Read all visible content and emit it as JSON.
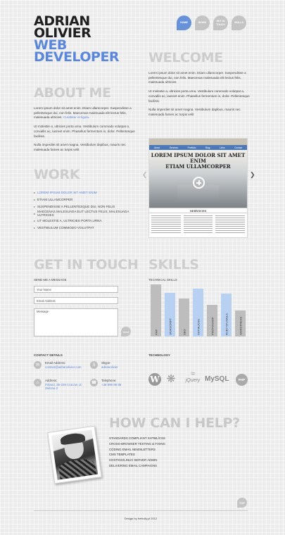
{
  "header": {
    "name_line1": "ADRIAN",
    "name_line2": "OLIVIER",
    "title_line1": "WEB",
    "title_line2": "DEVELOPER"
  },
  "nav": {
    "items": [
      {
        "label": "HOME",
        "active": true
      },
      {
        "label": "WORK",
        "active": false
      },
      {
        "label": "GET IN TOUCH",
        "active": false
      },
      {
        "label": "SKILLS",
        "active": false
      }
    ]
  },
  "about": {
    "heading": "ABOUT ME",
    "p1": "Lorem ipsum dolor sit amet enim. Etiam ullamcorper. Suspendisse a pellentesque dui, non felis. Maecenas malesuada elit lectus felis, malesuada ultricies.",
    "p1_link": "Curabitur et ligula.",
    "p2": "Ut molestie a, ultricies porta urna. Vestibulum commodo volutpat a, convallis ac, laoreet enim. Phasellus fermentum in, dolor. Pellentesque facilisis.",
    "p3": "Nulla imperdiet sit amet magna. Vestibulum dapibus, mauris nec malesuada fames ac turpis velit"
  },
  "welcome": {
    "heading": "WELCOME",
    "p1": "Lorem ipsum dolor sit amet enim. Etiam ullamcorper. Suspendisse a pellentesque dui, non felis. Maecenas malesuada elit lectus felis, malesuada ultricies.",
    "p2": "Ut molestie a, ultricies porta urna. Vestibulum commodo volutpat a, convallis ac, laoreet enim. Phasellus fermentum in, dolor. Pellentesque facilisis.",
    "p3": "Nulla imperdiet sit amet magna. Vestibulum dapibus, mauris nec malesuada fames ac turpis velit"
  },
  "work": {
    "heading": "WORK",
    "items": [
      {
        "label": "LOREM IPSUM DOLOR SIT AMET ENIM",
        "active": true
      },
      {
        "label": "ETIAM ULLAMCORPER",
        "active": false
      },
      {
        "label": "SUSPENDISSE A PELLENTESQUE DUI, NON FELIS",
        "active": false
      },
      {
        "label": "MAECENAS MALESUADA ELIT LECTUS FELIS, MALESUADA ULTRICIES",
        "active": false
      },
      {
        "label": "UT MOLESTIE A, ULTRICIES PORTA URNA",
        "active": false
      },
      {
        "label": "VESTIBULUM COMMODO VOLUTPAT",
        "active": false
      }
    ],
    "preview": {
      "nav": [
        "About",
        "Services",
        "Portfolio",
        "Blog",
        "Links",
        "Contact"
      ],
      "headline1": "LOREM IPSUM DOLOR SIT AMET ENIM",
      "headline2": "ETIAM ULLAMCORPER",
      "services_label": "SERVICES"
    }
  },
  "contact_form": {
    "heading": "GET IN TOUCH",
    "subheading": "SEND ME A MESSAGE",
    "name_placeholder": "Your Name",
    "email_placeholder": "Email Address",
    "message_placeholder": "Message",
    "send_label": "send"
  },
  "skills": {
    "heading": "SKILLS",
    "subheading": "TECHNICAL SKILLS"
  },
  "chart_data": {
    "type": "bar",
    "categories": [
      "PHP",
      "JAVASCRIPT",
      "SEO",
      "XHTML/CSS",
      "PHOTOSHOP",
      "RUBY ON RAILS",
      "WORDPRESS"
    ],
    "values": [
      100,
      84,
      73,
      92,
      61,
      83,
      50
    ],
    "colors": [
      "#bdbdbd",
      "#b8d0f2",
      "#bdbdbd",
      "#b8d0f2",
      "#bdbdbd",
      "#b8d0f2",
      "#bdbdbd"
    ],
    "ylim": [
      0,
      100
    ],
    "title": "",
    "xlabel": "",
    "ylabel": ""
  },
  "contact_details": {
    "heading": "CONTACT DETAILS",
    "email_label": "Email Address:",
    "email_value": "contact@adrianolivier.com",
    "skype_label": "Skype:",
    "skype_value": "adrianolivier",
    "address_label": "Address:",
    "address_value": "Poland, 39-229 Cracow, ul. Zielona 2",
    "phone_label": "Telephone:",
    "phone_value": "+48 999 99 99"
  },
  "technology": {
    "heading": "TECHNOLOGY",
    "logos": [
      "wordpress-icon",
      "joomla-icon",
      "jquery-icon",
      "mysql-icon",
      "php-icon"
    ],
    "jquery_label": "jQuery",
    "mysql_label": "MySQL",
    "php_label": "PHP"
  },
  "help": {
    "heading": "HOW CAN I HELP?",
    "items": [
      "STANDARDS COMPLIANT XHTML/CSS",
      "CROSS-BROWSER TESTING & FIXING",
      "CODING EMAIL NEWSLETTERS",
      "CMS TEMPLATES",
      "HOSTING/LINUX SERVER ADMIN",
      "DELIVERING EMAIL CAMPAIGNS"
    ]
  },
  "footer": {
    "credit": "Design by leeholly.pl 2012",
    "top_label": "TOP"
  }
}
